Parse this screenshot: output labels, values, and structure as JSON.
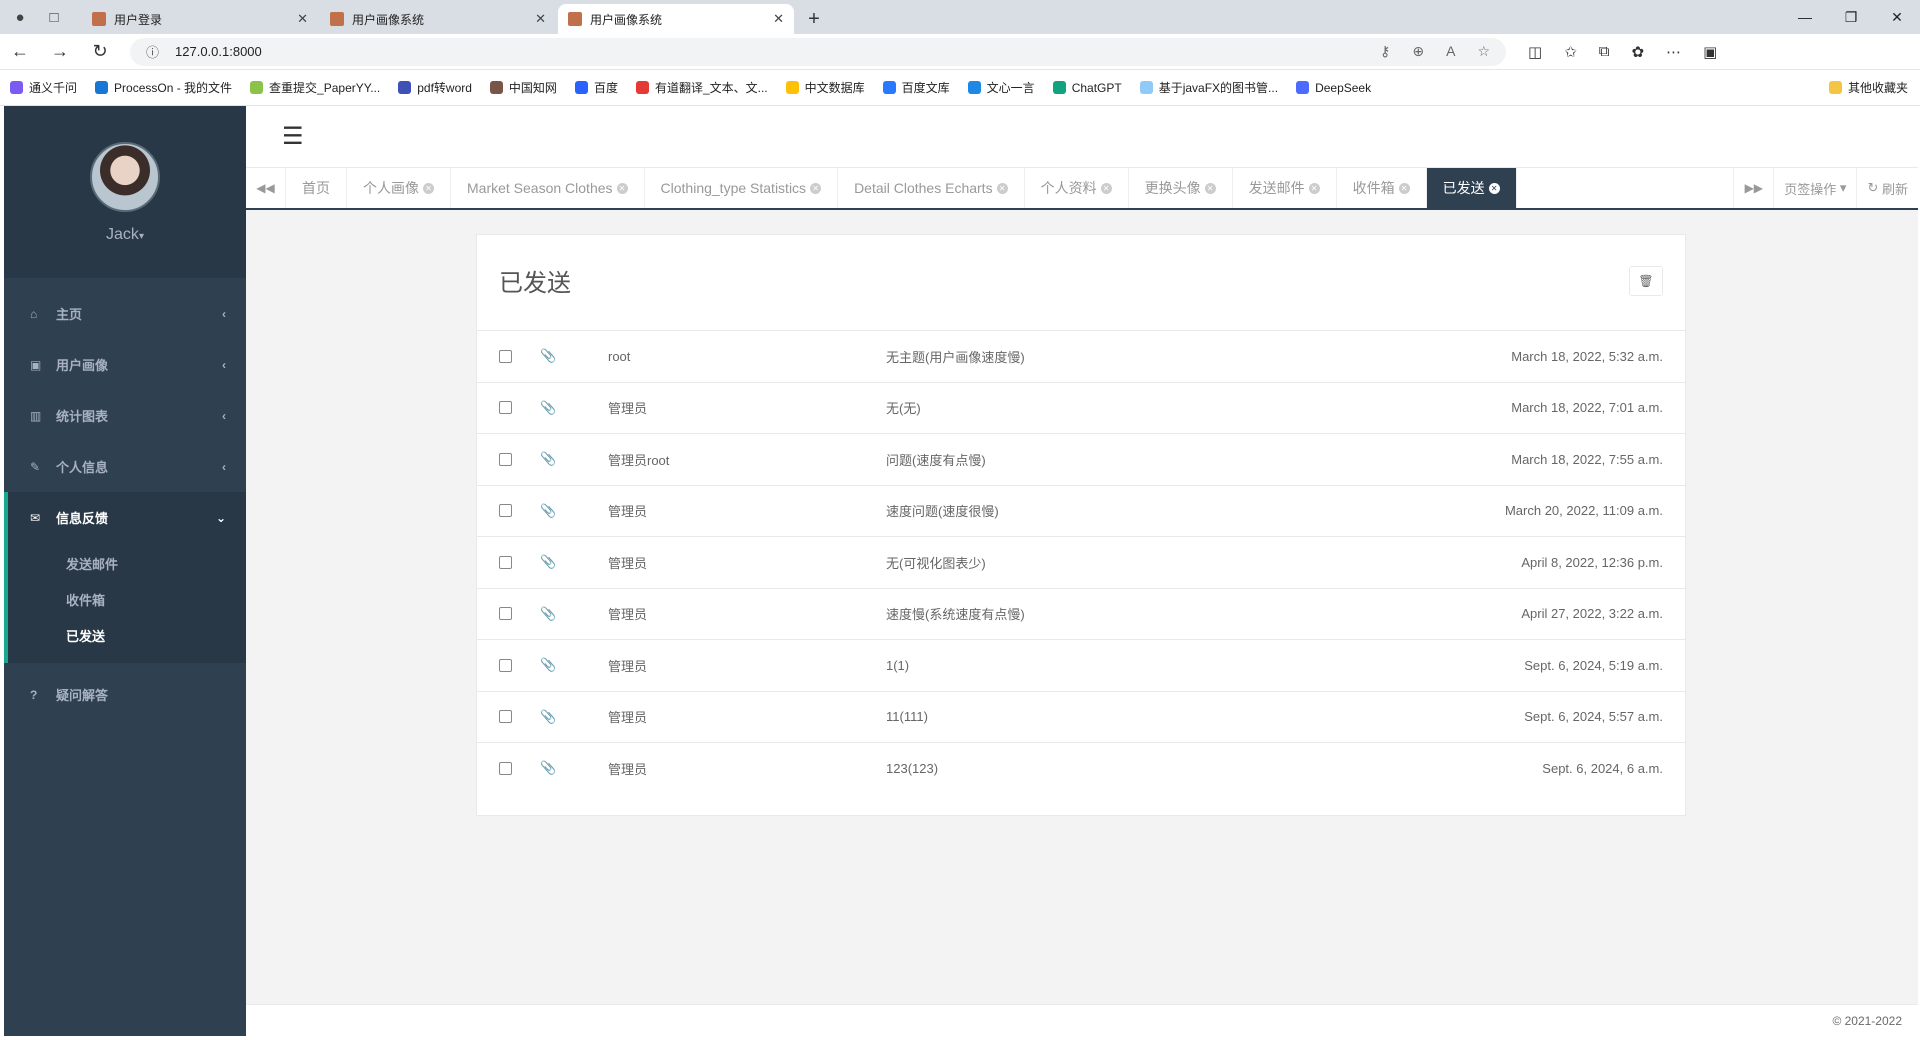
{
  "browser": {
    "tabs": [
      {
        "title": "用户登录",
        "active": false
      },
      {
        "title": "用户画像系统",
        "active": false
      },
      {
        "title": "用户画像系统",
        "active": true
      }
    ],
    "url": "127.0.0.1:8000",
    "bookmarks": [
      "通义千问",
      "ProcessOn - 我的文件",
      "查重提交_PaperYY...",
      "pdf转word",
      "中国知网",
      "百度",
      "有道翻译_文本、文...",
      "中文数据库",
      "百度文库",
      "文心一言",
      "ChatGPT",
      "基于javaFX的图书管...",
      "DeepSeek"
    ],
    "other_bookmarks": "其他收藏夹"
  },
  "sidebar": {
    "username": "Jack",
    "menu": [
      {
        "label": "主页",
        "icon": "home-icon"
      },
      {
        "label": "用户画像",
        "icon": "picture-icon"
      },
      {
        "label": "统计图表",
        "icon": "bar-chart-icon"
      },
      {
        "label": "个人信息",
        "icon": "edit-icon"
      },
      {
        "label": "信息反馈",
        "icon": "envelope-icon"
      }
    ],
    "submenu": [
      "发送邮件",
      "收件箱",
      "已发送"
    ],
    "help": "疑问解答"
  },
  "content_tabs": [
    "首页",
    "个人画像",
    "Market Season Clothes",
    "Clothing_type Statistics",
    "Detail Clothes Echarts",
    "个人资料",
    "更换头像",
    "发送邮件",
    "收件箱",
    "已发送"
  ],
  "tab_actions": {
    "page_ops": "页签操作",
    "refresh": "刷新"
  },
  "panel": {
    "title": "已发送",
    "rows": [
      {
        "to": "root",
        "subject": "无主题(用户画像速度慢)",
        "date": "March 18, 2022, 5:32 a.m."
      },
      {
        "to": "管理员",
        "subject": "无(无)",
        "date": "March 18, 2022, 7:01 a.m."
      },
      {
        "to": "管理员root",
        "subject": "问题(速度有点慢)",
        "date": "March 18, 2022, 7:55 a.m."
      },
      {
        "to": "管理员",
        "subject": "速度问题(速度很慢)",
        "date": "March 20, 2022, 11:09 a.m."
      },
      {
        "to": "管理员",
        "subject": "无(可视化图表少)",
        "date": "April 8, 2022, 12:36 p.m."
      },
      {
        "to": "管理员",
        "subject": "速度慢(系统速度有点慢)",
        "date": "April 27, 2022, 3:22 a.m."
      },
      {
        "to": "管理员",
        "subject": "1(1)",
        "date": "Sept. 6, 2024, 5:19 a.m."
      },
      {
        "to": "管理员",
        "subject": "11(111)",
        "date": "Sept. 6, 2024, 5:57 a.m."
      },
      {
        "to": "管理员",
        "subject": "123(123)",
        "date": "Sept. 6, 2024, 6 a.m."
      }
    ]
  },
  "footer": "© 2021-2022",
  "colors": {
    "sidebar": "#2f4050",
    "sidebar_dark": "#293846",
    "accent": "#19aa8d"
  }
}
